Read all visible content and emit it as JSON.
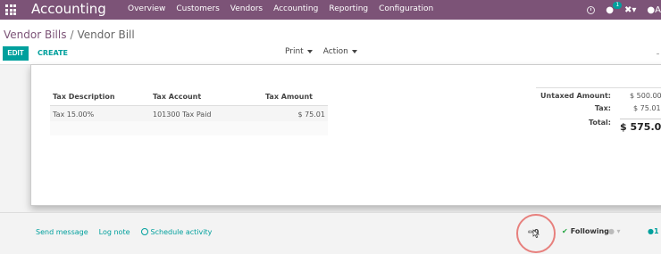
{
  "topbar": {
    "app_title": "Accounting",
    "menu": [
      "Overview",
      "Customers",
      "Vendors",
      "Accounting",
      "Reporting",
      "Configuration"
    ],
    "chat_badge": "1",
    "icons": [
      "apps-icon",
      "clock-icon",
      "chat-icon",
      "tools-icon",
      "user-icon"
    ]
  },
  "control_panel": {
    "breadcrumb_parent": "Vendor Bills",
    "breadcrumb_sep": "/",
    "breadcrumb_current": "Vendor Bill",
    "edit_label": "EDIT",
    "create_label": "CREATE",
    "print_label": "Print",
    "action_label": "Action"
  },
  "tax_table": {
    "headers": [
      "Tax Description",
      "Tax Account",
      "Tax Amount"
    ],
    "rows": [
      [
        "Tax 15.00%",
        "101300 Tax Paid",
        "$ 75.01"
      ]
    ]
  },
  "totals": {
    "untaxed_label": "Untaxed Amount:",
    "untaxed_value": "$ 500.00",
    "tax_label": "Tax:",
    "tax_value": "$ 75.01",
    "total_label": "Total:",
    "total_value": "$ 575.01"
  },
  "chatter": {
    "send_message": "Send message",
    "log_note": "Log note",
    "schedule_activity": "Schedule activity",
    "attachments_count": "0",
    "following_label": "Following",
    "followers_count": "1"
  },
  "colors": {
    "brand": "#7c5377",
    "accent": "#00a09d",
    "highlight": "#e7807d"
  }
}
